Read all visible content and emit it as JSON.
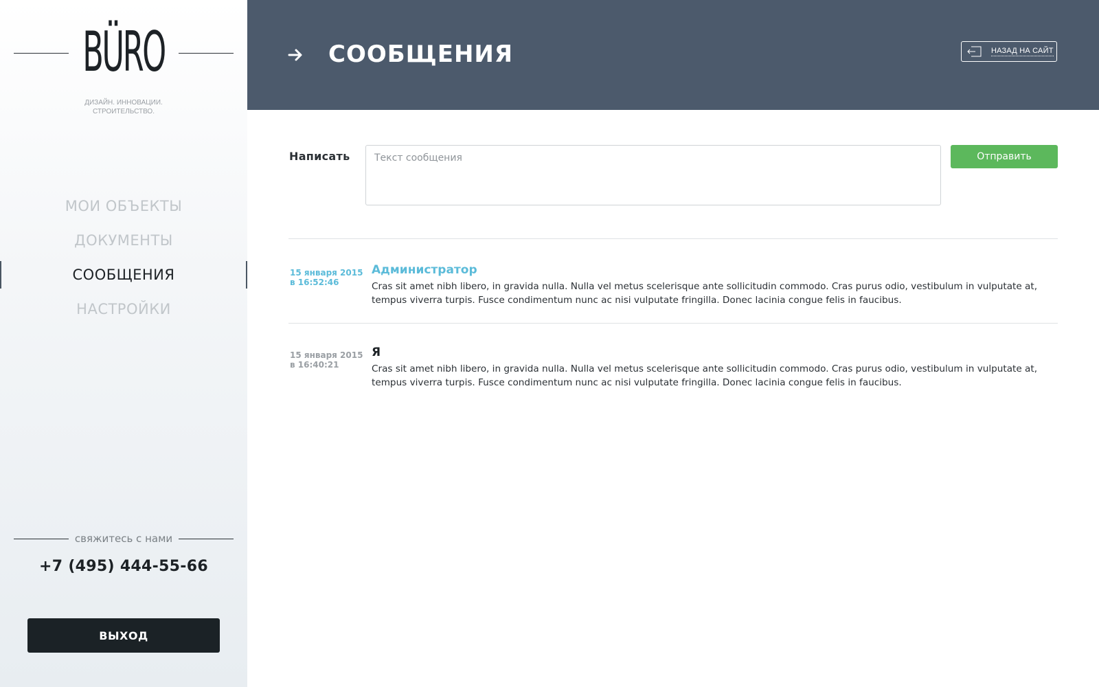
{
  "brand": {
    "logo": "BÜRO",
    "tagline_line1": "ДИЗАЙН. ИННОВАЦИИ.",
    "tagline_line2": "СТРОИТЕЛЬСТВО."
  },
  "nav": {
    "items": [
      {
        "label": "МОИ ОБЪЕКТЫ",
        "active": false
      },
      {
        "label": "ДОКУМЕНТЫ",
        "active": false
      },
      {
        "label": "СООБЩЕНИЯ",
        "active": true
      },
      {
        "label": "НАСТРОЙКИ",
        "active": false
      }
    ]
  },
  "contact": {
    "label": "свяжитесь с нами",
    "phone": "+7 (495) 444-55-66"
  },
  "logout_label": "ВЫХОД",
  "header": {
    "title": "СООБЩЕНИЯ",
    "back_label": "НАЗАД НА САЙТ",
    "arrow_icon": "arrow-right-icon",
    "back_icon": "exit-door-icon",
    "background": "#4c5a6c"
  },
  "compose": {
    "label": "Написать",
    "placeholder": "Текст сообщения",
    "value": "",
    "send_label": "Отправить",
    "send_color": "#5cb85c"
  },
  "messages": [
    {
      "date_line1": "15 января 2015",
      "date_line2": "в 16:52:46",
      "author": "Администратор",
      "accent": true,
      "text": "Cras sit amet nibh libero, in gravida nulla. Nulla vel metus scelerisque ante sollicitudin commodo. Cras purus odio, vestibulum in vulputate at, tempus viverra turpis. Fusce condimentum nunc ac nisi vulputate fringilla. Donec lacinia congue felis in faucibus."
    },
    {
      "date_line1": "15 января 2015",
      "date_line2": "в 16:40:21",
      "author": "Я",
      "accent": false,
      "text": "Cras sit amet nibh libero, in gravida nulla. Nulla vel metus scelerisque ante sollicitudin commodo. Cras purus odio, vestibulum in vulputate at, tempus viverra turpis. Fusce condimentum nunc ac nisi vulputate fringilla. Donec lacinia congue felis in faucibus."
    }
  ],
  "colors": {
    "accent": "#5bbbd9",
    "dark": "#1b2226",
    "nav_inactive": "#c1c6ca"
  }
}
